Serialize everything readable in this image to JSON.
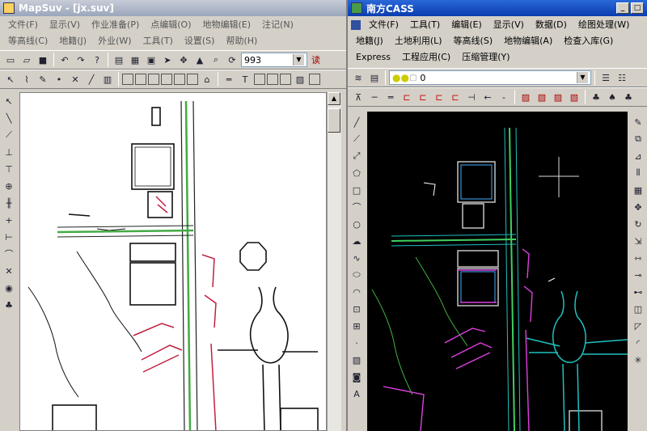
{
  "left": {
    "title": "MapSuv - [jx.suv]",
    "menu_row1": [
      "文件(F)",
      "显示(V)",
      "作业准备(P)",
      "点编辑(O)",
      "地物编辑(E)",
      "注记(N)",
      "等高线(C)",
      "地籍(J)"
    ],
    "menu_row2": [
      "外业(W)",
      "工具(T)",
      "设置(S)",
      "帮助(H)"
    ],
    "layer_value": "993",
    "read_label": "读"
  },
  "right": {
    "title": "南方CASS",
    "menu_row1": [
      "文件(F)",
      "工具(T)",
      "编辑(E)",
      "显示(V)",
      "数据(D)",
      "绘图处理(W)",
      "地籍(J)"
    ],
    "menu_row2": [
      "土地利用(L)",
      "等高线(S)",
      "地物编辑(A)",
      "检查入库(G)",
      "Express",
      "工程应用(C)"
    ],
    "menu_row3": [
      "压缩管理(Y)"
    ],
    "layer_value": "0"
  },
  "colors": {
    "cad_bg": "#000000",
    "left_canvas": "#ffffff",
    "accent_title": "#0a3cb0"
  }
}
